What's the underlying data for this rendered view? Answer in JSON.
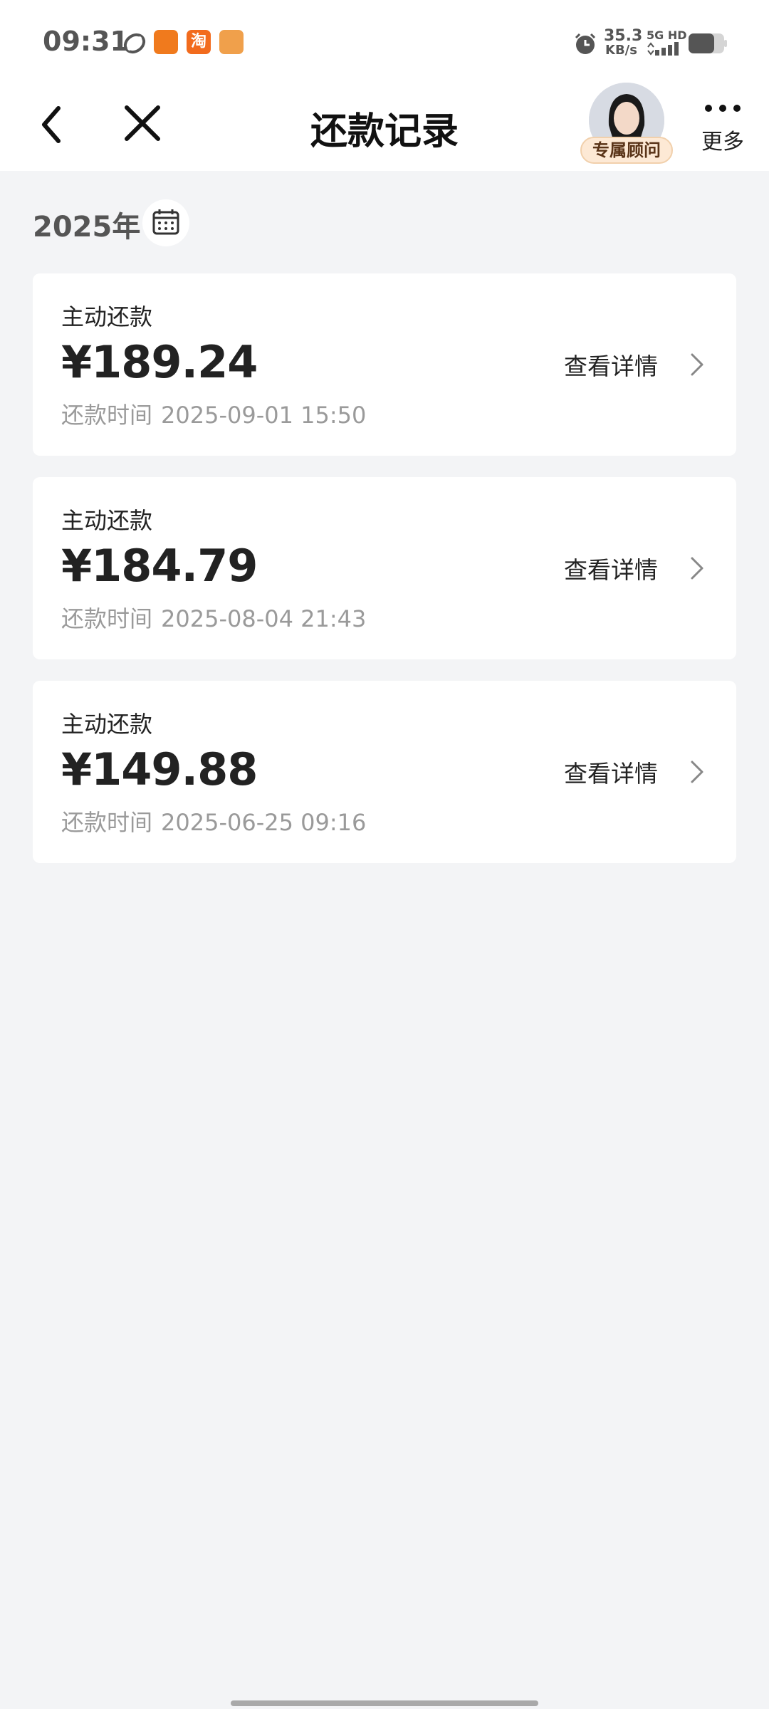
{
  "status_bar": {
    "time": "09:31",
    "app_icons": [
      "sync-icon",
      "app-icon-orange",
      "taobao-icon",
      "cat-app-icon"
    ],
    "network_speed_value": "35.3",
    "network_speed_unit": "KB/s",
    "network_type": "5G HD",
    "alarm_icon": "alarm-icon",
    "battery_icon": "battery-icon"
  },
  "nav": {
    "title": "还款记录",
    "back_icon": "back-arrow-icon",
    "close_icon": "close-icon",
    "advisor_badge": "专属顾问",
    "more_label": "更多"
  },
  "filter": {
    "year": "2025年",
    "calendar_icon": "calendar-icon"
  },
  "records": [
    {
      "type": "主动还款",
      "amount": "¥189.24",
      "time_label": "还款时间",
      "time_value": "2025-09-01 15:50",
      "detail_label": "查看详情"
    },
    {
      "type": "主动还款",
      "amount": "¥184.79",
      "time_label": "还款时间",
      "time_value": "2025-08-04 21:43",
      "detail_label": "查看详情"
    },
    {
      "type": "主动还款",
      "amount": "¥149.88",
      "time_label": "还款时间",
      "time_value": "2025-06-25 09:16",
      "detail_label": "查看详情"
    }
  ],
  "colors": {
    "background": "#f3f4f6",
    "card": "#ffffff",
    "primary_text": "#222222",
    "secondary_text": "#9a9a9a",
    "advisor_badge_bg": "#fde9d5"
  }
}
